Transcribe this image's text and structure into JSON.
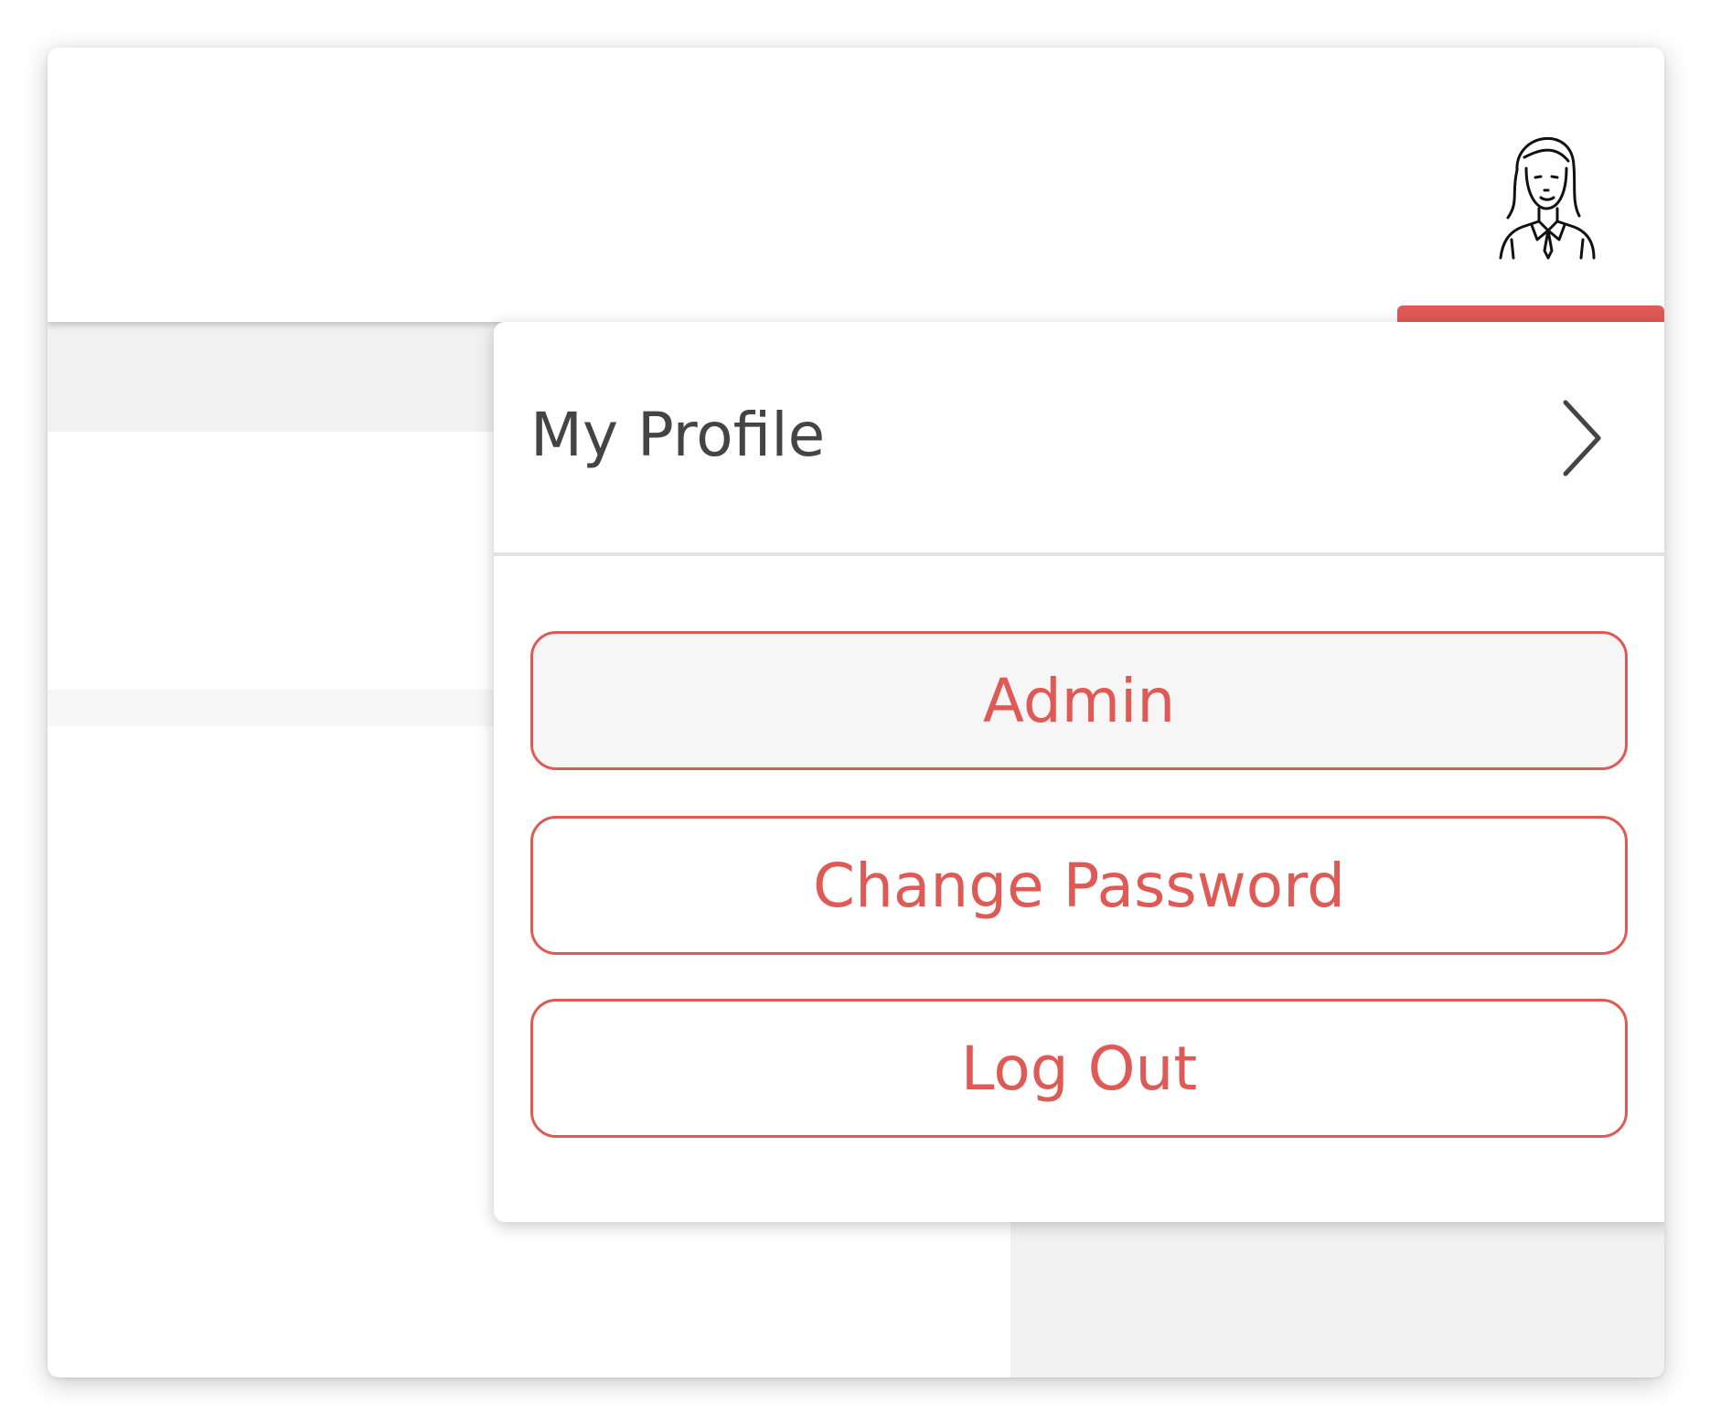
{
  "header": {
    "avatar_icon": "woman-avatar-icon"
  },
  "menu": {
    "profile_label": "My Profile",
    "profile_chevron_icon": "chevron-right-icon",
    "items": [
      {
        "label": "Admin",
        "active": true
      },
      {
        "label": "Change Password",
        "active": false
      },
      {
        "label": "Log Out",
        "active": false
      }
    ]
  },
  "colors": {
    "accent": "#e05a55",
    "text": "#444444",
    "divider": "#e2e2e2"
  }
}
